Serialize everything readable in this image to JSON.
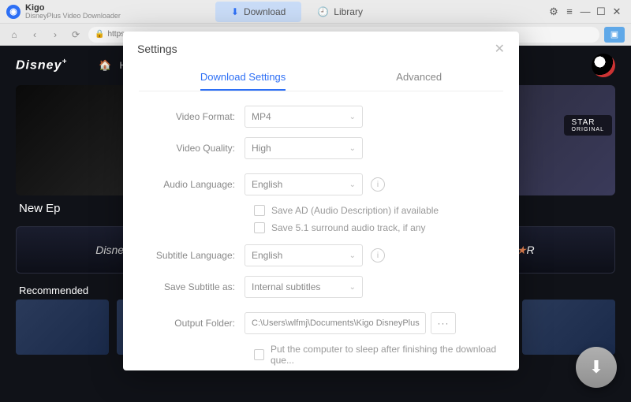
{
  "app": {
    "title": "Kigo",
    "subtitle": "DisneyPlus Video Downloader",
    "tabs": {
      "download": "Download",
      "library": "Library"
    },
    "url": "https:"
  },
  "background": {
    "disney_logo": "Disney",
    "plus": "+",
    "home_initial": "H",
    "new_episodes": "New Ep",
    "brand_disney": "Disney",
    "brand_star": "ST★R",
    "star_badge": "STAR",
    "star_original": "ORIGINAL",
    "recommended": "Recommended"
  },
  "modal": {
    "title": "Settings",
    "tabs": {
      "download": "Download Settings",
      "advanced": "Advanced"
    },
    "labels": {
      "video_format": "Video Format:",
      "video_quality": "Video Quality:",
      "audio_language": "Audio Language:",
      "subtitle_language": "Subtitle Language:",
      "save_subtitle_as": "Save Subtitle as:",
      "output_folder": "Output Folder:"
    },
    "values": {
      "video_format": "MP4",
      "video_quality": "High",
      "audio_language": "English",
      "subtitle_language": "English",
      "save_subtitle_as": "Internal subtitles",
      "output_folder": "C:\\Users\\wlfmj\\Documents\\Kigo DisneyPlus"
    },
    "checks": {
      "save_ad": "Save AD (Audio Description) if available",
      "save_51": "Save 5.1 surround audio track, if any",
      "sleep": "Put the computer to sleep after finishing the download que..."
    },
    "browse": "···"
  }
}
